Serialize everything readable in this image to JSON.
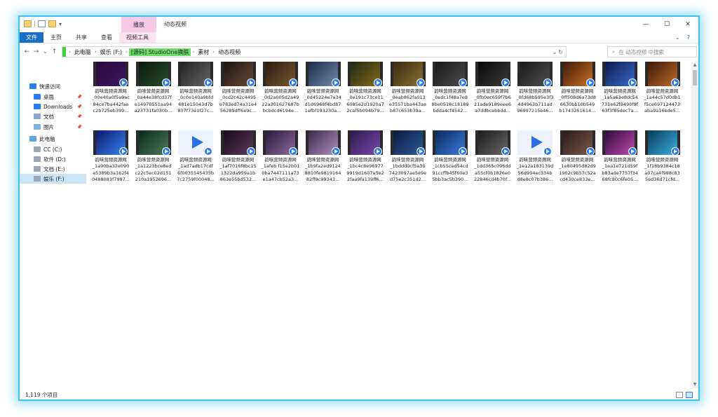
{
  "window": {
    "context_tab": "播放",
    "title": "动态视频",
    "controls": [
      "—",
      "☐",
      "✕"
    ]
  },
  "ribbon": {
    "tabs": [
      "文件",
      "主页",
      "共享",
      "查看",
      "视频工具"
    ],
    "help_chevron": "⌄",
    "help": "?"
  },
  "address": {
    "crumbs": [
      "此电脑",
      "娱乐 (F:)",
      "[源码] StudioOne换肤",
      "素材",
      "动态视频"
    ],
    "search_placeholder": "在 动态视频 中搜索"
  },
  "nav_pane": {
    "items": [
      {
        "label": "快速访问",
        "icon": "star-icon",
        "color": "#2b7be8",
        "pinned": false,
        "selected": false
      },
      {
        "label": "桌面",
        "icon": "desktop-folder-icon",
        "color": "#2b7be8",
        "pinned": true,
        "selected": false
      },
      {
        "label": "Downloads",
        "icon": "download-icon",
        "color": "#2b7be8",
        "pinned": true,
        "selected": false
      },
      {
        "label": "文档",
        "icon": "documents-icon",
        "color": "#8aa6c8",
        "pinned": true,
        "selected": false
      },
      {
        "label": "图片",
        "icon": "pictures-icon",
        "color": "#7fb0d8",
        "pinned": true,
        "selected": false
      },
      {
        "label": "此电脑",
        "icon": "this-pc-icon",
        "color": "#5fa4e0",
        "pinned": false,
        "selected": false
      },
      {
        "label": "CC (C:)",
        "icon": "drive-icon",
        "color": "#9aa6b3",
        "pinned": false,
        "selected": false
      },
      {
        "label": "软件 (D:)",
        "icon": "drive-icon",
        "color": "#9aa6b3",
        "pinned": false,
        "selected": false
      },
      {
        "label": "文档 (E:)",
        "icon": "drive-icon",
        "color": "#9aa6b3",
        "pinned": false,
        "selected": false
      },
      {
        "label": "娱乐 (F:)",
        "icon": "drive-icon",
        "color": "#9aa6b3",
        "pinned": false,
        "selected": true
      }
    ]
  },
  "files": [
    {
      "l1": "韵味营频资源网",
      "l2": "_00e40a0f5a9ac",
      "l3": "84ce7ba442faa",
      "l4": "c2b725eb399...",
      "c1": "#2a0a3a",
      "c2": "#3a1a60",
      "ph": false
    },
    {
      "l1": "韵味营频资源网",
      "l2": "_0a44e38fcd37f",
      "l3": "e14970551aa94",
      "l4": "a23731fa030b...",
      "c1": "#0a1a10",
      "c2": "#2a4a2a",
      "ph": false
    },
    {
      "l1": "韵味营频资源网",
      "l2": "_0c0e140a9bfd",
      "l3": "681e15043d7b",
      "l4": "837f73e1f27c...",
      "c1": "#222",
      "c2": "#666",
      "ph": false
    },
    {
      "l1": "韵味营频资源网",
      "l2": "_0cd2c42c4495",
      "l3": "e783ed74a31e4",
      "l4": "56289dff6e9c...",
      "c1": "#1a1410",
      "c2": "#6a4a3a",
      "ph": false
    },
    {
      "l1": "韵味营频资源网",
      "l2": "_0d2a005d2a49",
      "l3": "22a301627687b",
      "l4": "bcbdcd6194e...",
      "c1": "#2a1a10",
      "c2": "#7a5a30",
      "ph": false
    },
    {
      "l1": "韵味营频资源网",
      "l2": "_0d45224e7a34",
      "l3": "d1d6968f4bd87",
      "l4": "1efbf193230a...",
      "c1": "#1a2a4a",
      "c2": "#7a8ab0",
      "ph": false
    },
    {
      "l1": "韵味营频资源网",
      "l2": "_0e191c73ce11",
      "l3": "6085e2d1920a7",
      "l4": "2caf5b094b79...",
      "c1": "#1a2a10",
      "c2": "#8a6a20",
      "ph": false
    },
    {
      "l1": "韵味营频资源网",
      "l2": "_0eab862fa013",
      "l3": "e35571ba443ae",
      "l4": "b87c653b39a...",
      "c1": "#3a2a10",
      "c2": "#8a7030",
      "ph": false
    },
    {
      "l1": "韵味营频资源网",
      "l2": "_0edc1f48a7e8",
      "l3": "8be0518c18189",
      "l4": "bdda4cf4542...",
      "c1": "#1a1a1a",
      "c2": "#4a4a4a",
      "ph": false
    },
    {
      "l1": "韵味营频资源网",
      "l2": "_0fb0ec659f7b6",
      "l3": "21ade9189eee6",
      "l4": "a7ddbcebbdd...",
      "c1": "#0a0a0a",
      "c2": "#3a3a3a",
      "ph": false
    },
    {
      "l1": "韵味营频资源网",
      "l2": "_0fd68b595e3f3",
      "l3": "4d4963b711ad",
      "l4": "96997215e46...",
      "c1": "#1a1a1a",
      "c2": "#505050",
      "ph": false
    },
    {
      "l1": "韵味营频资源网",
      "l2": "_0ff508d6a73d8",
      "l3": "6630bb10b549",
      "l4": "b1743251614...",
      "c1": "#3a1a0a",
      "c2": "#d07020",
      "ph": false
    },
    {
      "l1": "韵味营频资源网",
      "l2": "_1a5a63e8dc54",
      "l3": "731e62f8490f9f",
      "l4": "63f3f85dec7a...",
      "c1": "#0a1a4a",
      "c2": "#3a6ad0",
      "ph": false
    },
    {
      "l1": "韵味营频资源网",
      "l2": "_1a44c57d0db1",
      "l3": "f5ce697124473",
      "l4": "aba9a16ede5...",
      "c1": "#3a1a0a",
      "c2": "#c06a2a",
      "ph": false
    },
    {
      "l1": "韵味营频资源网",
      "l2": "_1a90ba37e090",
      "l3": "e5389b3a162f4",
      "l4": "0488083f7997...",
      "c1": "#0a1a6a",
      "c2": "#3a80f0",
      "ph": false
    },
    {
      "l1": "韵味营频资源网",
      "l2": "_1a1223bce8ed",
      "l3": "c22c5ec02d151",
      "l4": "210a1952696...",
      "c1": "#0a2a1a",
      "c2": "#4a7a5a",
      "ph": false
    },
    {
      "l1": "韵味营频资源网",
      "l2": "_1ad7adb17cdf",
      "l3": "6f0035545435b",
      "l4": "7c2759f00048...",
      "c1": "#eef3fb",
      "c2": "#eef3fb",
      "ph": true
    },
    {
      "l1": "韵味营频资源网",
      "l2": "_1af7016f8bc15",
      "l3": "1322da959a1b",
      "l4": "863e55bd532...",
      "c1": "#1a0a1a",
      "c2": "#5a3a5a",
      "ph": false
    },
    {
      "l1": "韵味营频资源网",
      "l2": "_1afeb f15e2b01",
      "l3": "0ba7447111a73",
      "l4": "e1a47cb52a3...",
      "c1": "#2a1a3a",
      "c2": "#8a6aa0",
      "ph": false
    },
    {
      "l1": "韵味营频资源网",
      "l2": "_1b9fa2ed9124",
      "l3": "8810fe9819164",
      "l4": "82ff9c99343...",
      "c1": "#3a2a4a",
      "c2": "#b090c0",
      "ph": false
    },
    {
      "l1": "韵味营频资源网",
      "l2": "_1bc4c8e96977",
      "l3": "9919d1607a5e2",
      "l4": "2faa9fa139ff6...",
      "c1": "#2a1a4a",
      "c2": "#7a4ab0",
      "ph": false
    },
    {
      "l1": "韵味营频资源网",
      "l2": "_1bddd0cf5a30",
      "l3": "7423097ae5e9e",
      "l4": "d75e2c351d2...",
      "c1": "#0a1a3a",
      "c2": "#2a5a9a",
      "ph": false
    },
    {
      "l1": "韵味营频资源网",
      "l2": "_1cb55ced54cd",
      "l3": "91ccffb45f60e3",
      "l4": "5bb3ac5b390...",
      "c1": "#0a2a5a",
      "c2": "#3a7ae0",
      "ph": false
    },
    {
      "l1": "韵味营频资源网",
      "l2": "_1dd365c096dd",
      "l3": "a55cf0b1826e0",
      "l4": "22846cd4b70f...",
      "c1": "#1a1a1a",
      "c2": "#6a6a6a",
      "ph": false
    },
    {
      "l1": "韵味营频资源网",
      "l2": "_1e12a183139d",
      "l3": "56d904ec334b",
      "l4": "d8e8c07b386...",
      "c1": "#eef3fb",
      "c2": "#eef3fb",
      "ph": true
    },
    {
      "l1": "韵味营频资源网",
      "l2": "_1e80495d82d9",
      "l3": "1902c9b57c52a",
      "l4": "cd430ce833e...",
      "c1": "#2a1a1a",
      "c2": "#7a5a4a",
      "ph": false
    },
    {
      "l1": "韵味营频资源网",
      "l2": "_1ea1e721d59f",
      "l3": "b83ade7757f34",
      "l4": "68fc80c6fe05...",
      "c1": "#2a0a3a",
      "c2": "#c04ab0",
      "ph": false
    },
    {
      "l1": "韵味营频资源网",
      "l2": "_1f18b9384c18",
      "l3": "a07ca4f988c83",
      "l4": "5ed36d71cfd...",
      "c1": "#0a3a5a",
      "c2": "#3ab0e0",
      "ph": false
    }
  ],
  "status_bar": {
    "item_count": "1,119 个项目"
  },
  "colors": {
    "accent": "#1a6fc4",
    "frame_glow": "#3ec0f0",
    "address_highlight": "#6ae06a",
    "context_tab": "#f7c9e6"
  }
}
